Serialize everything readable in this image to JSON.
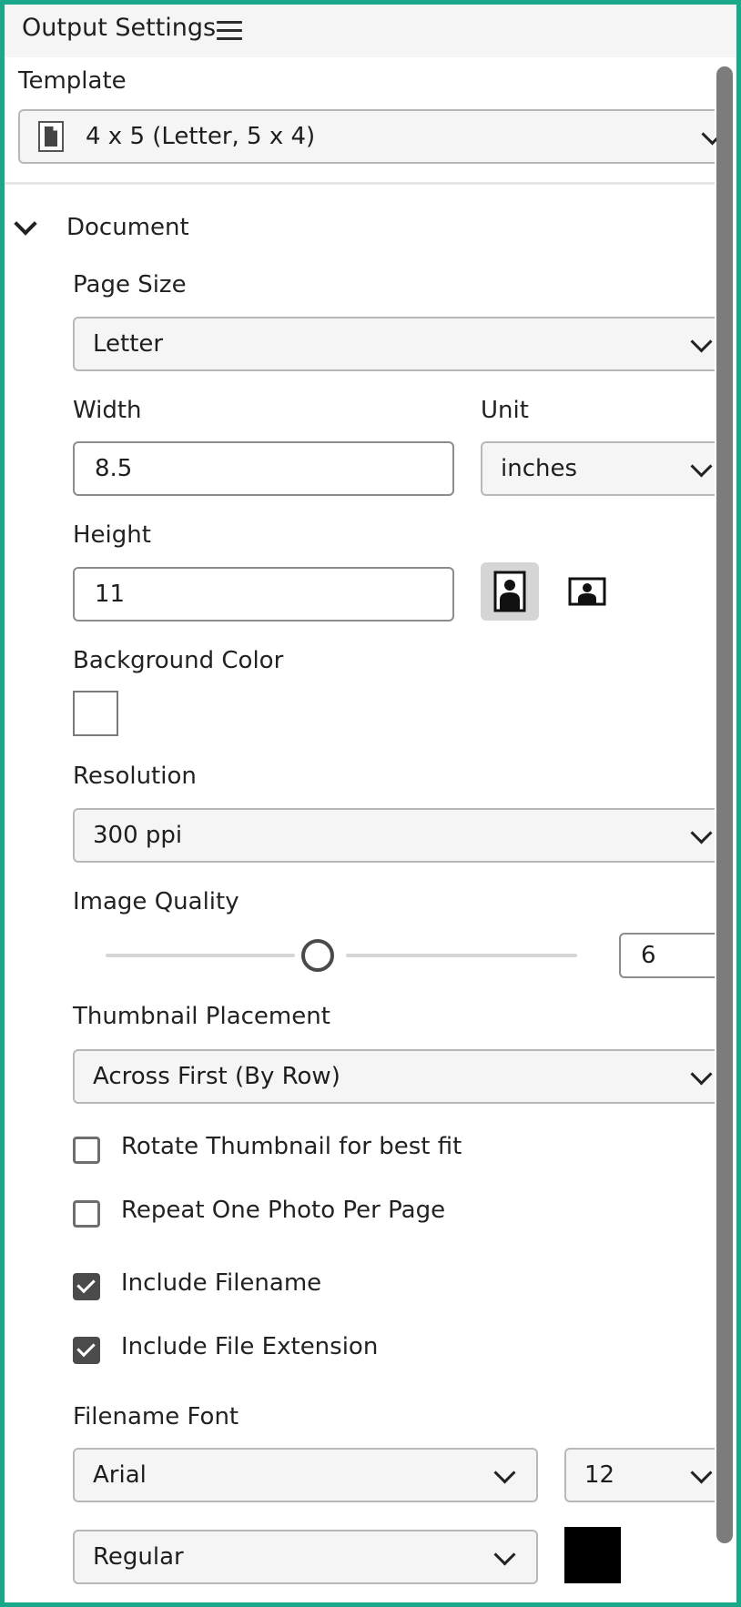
{
  "panel": {
    "title": "Output Settings"
  },
  "template": {
    "label": "Template",
    "value": "4 x 5 (Letter, 5 x 4)"
  },
  "document": {
    "section_label": "Document",
    "page_size": {
      "label": "Page Size",
      "value": "Letter"
    },
    "width": {
      "label": "Width",
      "value": "8.5"
    },
    "unit": {
      "label": "Unit",
      "value": "inches"
    },
    "height": {
      "label": "Height",
      "value": "11"
    },
    "orientation": {
      "selected": "portrait"
    },
    "background_color": {
      "label": "Background Color",
      "value": "#ffffff"
    },
    "resolution": {
      "label": "Resolution",
      "value": "300 ppi"
    },
    "image_quality": {
      "label": "Image Quality",
      "value": "6"
    },
    "thumbnail_placement": {
      "label": "Thumbnail Placement",
      "value": "Across First (By Row)"
    },
    "checkboxes": {
      "rotate": {
        "label": "Rotate Thumbnail for best fit",
        "checked": false
      },
      "repeat": {
        "label": "Repeat One Photo Per Page",
        "checked": false
      },
      "filename": {
        "label": "Include Filename",
        "checked": true
      },
      "extension": {
        "label": "Include File Extension",
        "checked": true
      }
    },
    "filename_font": {
      "label": "Filename Font",
      "family": "Arial",
      "size": "12",
      "style": "Regular",
      "color": "#000000"
    }
  },
  "colors": {
    "accent_border": "#19a98a"
  }
}
